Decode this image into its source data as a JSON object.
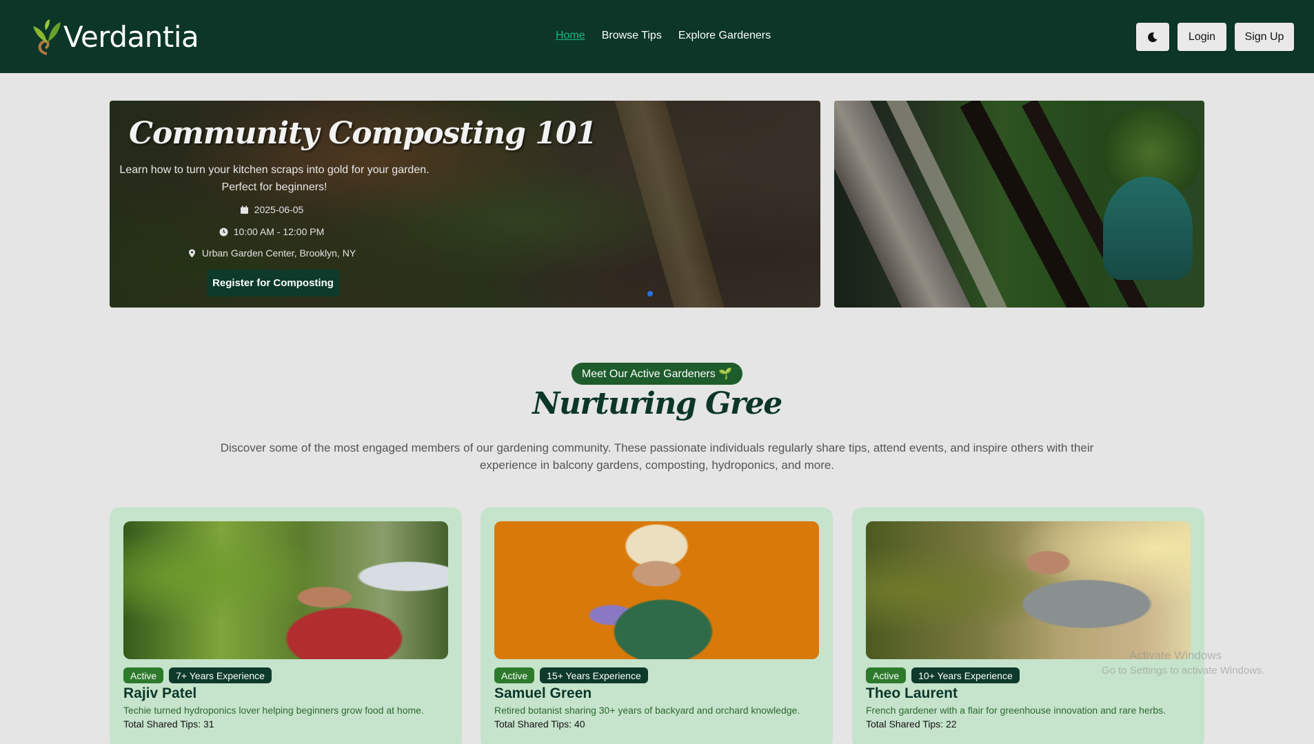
{
  "navbar": {
    "brand": "Verdantia",
    "links": [
      "Home",
      "Browse Tips",
      "Explore Gardeners"
    ],
    "theme_icon": "moon-icon",
    "login": "Login",
    "signup": "Sign Up",
    "bg_color": "#0b3628",
    "active_link_color": "#19b983"
  },
  "hero": {
    "title": "Community Composting 101",
    "description": "Learn how to turn your kitchen scraps into gold for your garden. Perfect for beginners!",
    "date": "2025-06-05",
    "time": "10:00 AM - 12:00 PM",
    "location": "Urban Garden Center, Brooklyn, NY",
    "cta": "Register for Composting"
  },
  "section": {
    "badge": "Meet Our Active Gardeners 🌱",
    "title": "Nurturing Gree",
    "description": "Discover some of the most engaged members of our gardening community. These passionate individuals regularly share tips, attend events, and inspire others with their experience in balcony gardens, composting, hydroponics, and more."
  },
  "gardeners": [
    {
      "status": "Active",
      "experience": "7+ Years Experience",
      "name": "Rajiv Patel",
      "bio": "Techie turned hydroponics lover helping beginners grow food at home.",
      "tips": "Total Shared Tips: 31"
    },
    {
      "status": "Active",
      "experience": "15+ Years Experience",
      "name": "Samuel Green",
      "bio": "Retired botanist sharing 30+ years of backyard and orchard knowledge.",
      "tips": "Total Shared Tips: 40"
    },
    {
      "status": "Active",
      "experience": "10+ Years Experience",
      "name": "Theo Laurent",
      "bio": "French gardener with a flair for greenhouse innovation and rare herbs.",
      "tips": "Total Shared Tips: 22"
    }
  ],
  "watermark": {
    "line1": "Activate Windows",
    "line2": "Go to Settings to activate Windows."
  }
}
